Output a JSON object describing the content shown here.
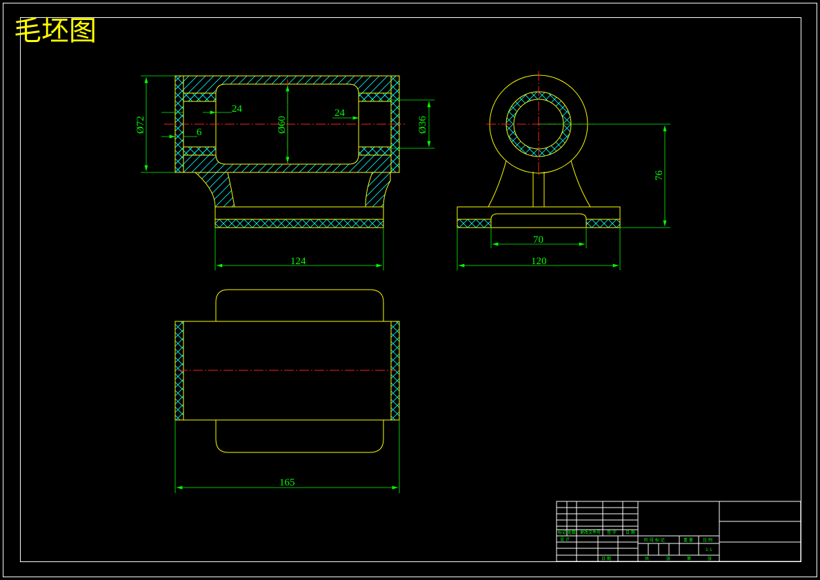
{
  "drawing": {
    "title": "毛坯图",
    "colors": {
      "background": "#000000",
      "frame": "#ffffff",
      "outline": "#ffff00",
      "dimension": "#00ff00",
      "centerline": "#ff2020"
    },
    "front_view": {
      "dims": {
        "d72": "Ø72",
        "d24_left": "24",
        "d6": "6",
        "d60": "Ø60",
        "d24_right": "24",
        "d36": "Ø36",
        "d124": "124"
      }
    },
    "side_view": {
      "dims": {
        "d76": "76",
        "d70": "70",
        "d120": "120"
      }
    },
    "top_view": {
      "dims": {
        "d165": "165"
      }
    },
    "title_block": {
      "labels": {
        "l1": "标记",
        "l2": "处数",
        "l3": "更改文件号",
        "l4": "签 字",
        "l5": "日 期",
        "l6": "设 计",
        "l7": "阶 段 标 记",
        "l8": "重 量",
        "l9": "比 例",
        "l10": "1:1",
        "l11": "日 期",
        "l12": "共",
        "l13": "张",
        "l14": "第",
        "l15": "张"
      }
    }
  }
}
